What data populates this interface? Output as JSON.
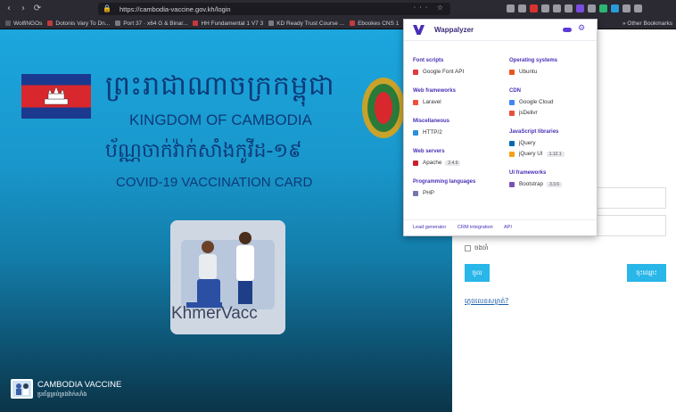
{
  "browser": {
    "nav": [
      "‹",
      "›",
      "⟳"
    ],
    "url": "https://cambodia-vaccine.gov.kh/login",
    "url_actions": "··· ☆",
    "bookmarks": [
      {
        "label": "WolfiNGOs",
        "color": "#5a5a66"
      },
      {
        "label": "Dotonis Vary To Dn...",
        "color": "#c23b3b"
      },
      {
        "label": "Port 37 · x64 G & Binar...",
        "color": "#7a7a85"
      },
      {
        "label": "HH Fundamental 1 V7 3",
        "color": "#c23b3b"
      },
      {
        "label": "KD Ready Trust Course ...",
        "color": "#7a7a85"
      },
      {
        "label": "Ebookes CNS 1",
        "color": "#c23b3b"
      }
    ],
    "other_bookmarks": "» Other Bookmarks",
    "ext_colors": [
      "#9a9aa4",
      "#9a9aa4",
      "#d6342f",
      "#9a9aa4",
      "#9a9aa4",
      "#9a9aa4",
      "#7b4ce0",
      "#9a9aa4",
      "#2bb673",
      "#2b9ad8",
      "#9a9aa4",
      "#9a9aa4"
    ]
  },
  "left": {
    "khmer_title": "ព្រះរាជាណាចក្រកម្ពុជា",
    "kingdom": "KINGDOM OF CAMBODIA",
    "khmer_sub": "ប័ណ្ណចាក់វ៉ាក់សាំងកូវីដ-១៩",
    "covid_card": "COVID-19 VACCINATION CARD",
    "logo_text": "KhmerVacc",
    "footer_title": "CAMBODIA VACCINE",
    "footer_sub": "ប្រព័ន្ធគ្រប់គ្រងវ៉ាក់សាំង"
  },
  "right": {
    "remember_label": "ចងចាំ",
    "btn_login": "ចូល",
    "btn_register": "ចុះឈ្មោះ",
    "forgot_link": "ភ្លេចលេខសម្ងាត់?"
  },
  "wappalyzer": {
    "title": "Wappalyzer",
    "left_col": [
      {
        "category": "Font scripts",
        "items": [
          {
            "name": "Google Font API",
            "color": "#e0393e",
            "version": ""
          }
        ]
      },
      {
        "category": "Web frameworks",
        "items": [
          {
            "name": "Laravel",
            "color": "#f0503a",
            "version": ""
          }
        ]
      },
      {
        "category": "Miscellaneous",
        "items": [
          {
            "name": "HTTP/2",
            "color": "#2d8fd5",
            "version": ""
          }
        ]
      },
      {
        "category": "Web servers",
        "items": [
          {
            "name": "Apache",
            "color": "#c8202f",
            "version": "2.4.6"
          }
        ]
      },
      {
        "category": "Programming languages",
        "items": [
          {
            "name": "PHP",
            "color": "#7377ad",
            "version": ""
          }
        ]
      }
    ],
    "right_col": [
      {
        "category": "Operating systems",
        "items": [
          {
            "name": "Ubuntu",
            "color": "#e95420",
            "version": ""
          }
        ]
      },
      {
        "category": "CDN",
        "items": [
          {
            "name": "Google Cloud",
            "color": "#4285f4",
            "version": ""
          },
          {
            "name": "jsDelivr",
            "color": "#e84d3d",
            "version": ""
          }
        ]
      },
      {
        "category": "JavaScript libraries",
        "items": [
          {
            "name": "jQuery",
            "color": "#0769ad",
            "version": ""
          },
          {
            "name": "jQuery UI",
            "color": "#f6a01a",
            "version": "1.12.1"
          }
        ]
      },
      {
        "category": "UI frameworks",
        "items": [
          {
            "name": "Bootstrap",
            "color": "#7952b3",
            "version": "3.3.6"
          }
        ]
      }
    ],
    "footer": [
      "Lead generator",
      "CRM integration",
      "API"
    ]
  }
}
